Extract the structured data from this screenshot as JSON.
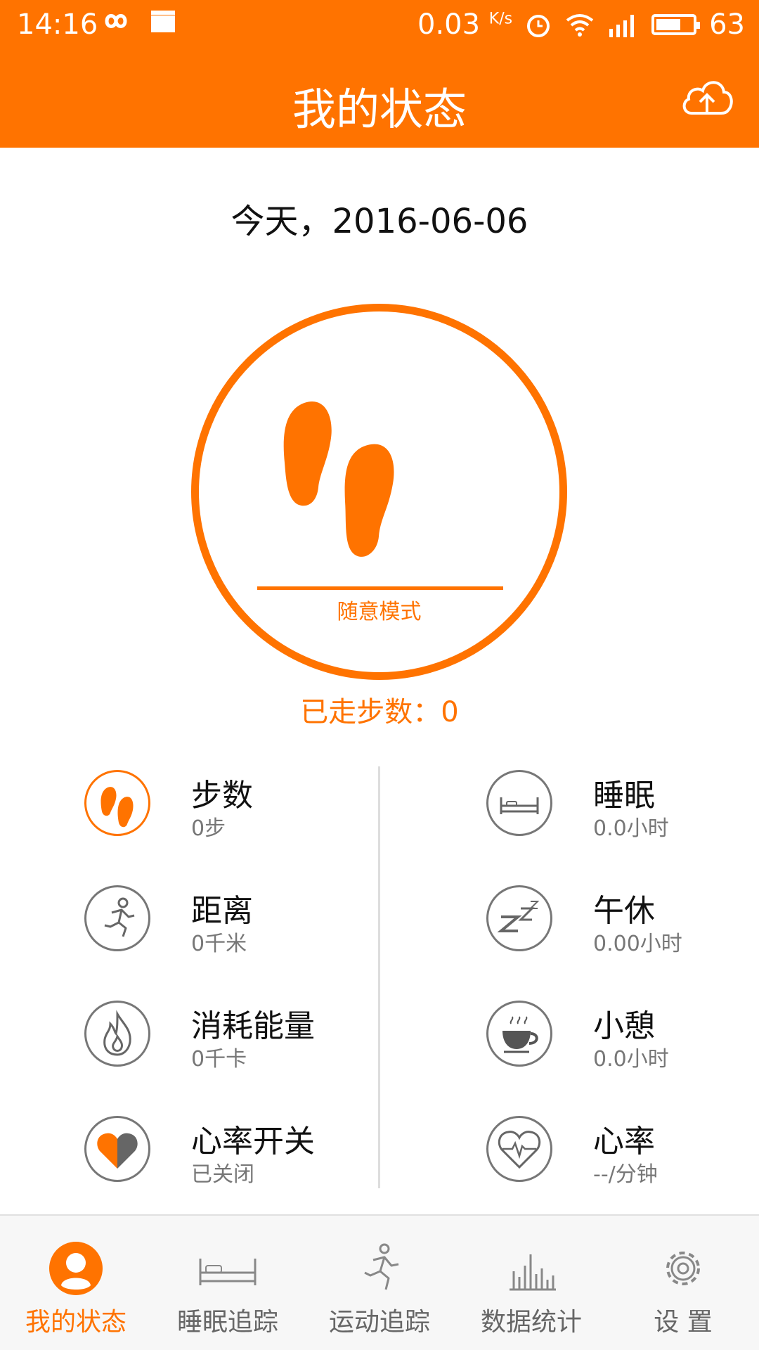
{
  "status_bar": {
    "time": "14:16",
    "speed": "0.03",
    "speed_unit": "K/s",
    "battery": "63"
  },
  "header": {
    "title": "我的状态",
    "upload_icon": "cloud-upload-icon"
  },
  "date": "今天，2016-06-06",
  "main": {
    "mode_label": "随意模式",
    "steps_walked": "已走步数：0"
  },
  "stats": {
    "left": [
      {
        "icon": "footprints-icon",
        "title": "步数",
        "value": "0步"
      },
      {
        "icon": "running-icon",
        "title": "距离",
        "value": "0千米"
      },
      {
        "icon": "flame-icon",
        "title": "消耗能量",
        "value": "0千卡"
      },
      {
        "icon": "heart-toggle-icon",
        "title": "心率开关",
        "value": "已关闭"
      }
    ],
    "right": [
      {
        "icon": "bed-icon",
        "title": "睡眠",
        "value": "0.0小时"
      },
      {
        "icon": "zzz-icon",
        "title": "午休",
        "value": "0.00小时"
      },
      {
        "icon": "coffee-cup-icon",
        "title": "小憩",
        "value": "0.0小时"
      },
      {
        "icon": "heart-rate-icon",
        "title": "心率",
        "value": "--/分钟"
      }
    ]
  },
  "bottom_nav": [
    {
      "icon": "user-icon",
      "label": "我的状态",
      "active": true
    },
    {
      "icon": "bed-icon",
      "label": "睡眠追踪",
      "active": false
    },
    {
      "icon": "running-icon",
      "label": "运动追踪",
      "active": false
    },
    {
      "icon": "bar-chart-icon",
      "label": "数据统计",
      "active": false
    },
    {
      "icon": "gear-icon",
      "label": "设 置",
      "active": false
    }
  ],
  "colors": {
    "accent": "#ff7300",
    "icon_gray": "#777777"
  }
}
